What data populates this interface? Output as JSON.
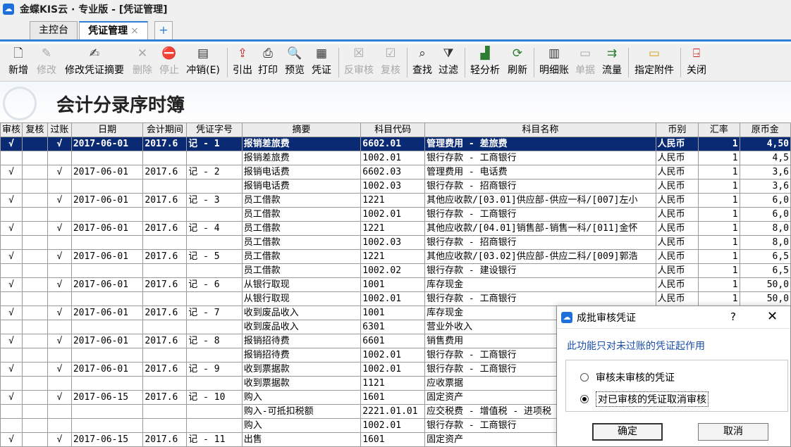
{
  "app": {
    "title": "金蝶KIS云 · 专业版 - [凭证管理]",
    "icon": "kis-app-icon"
  },
  "tabs": [
    {
      "label": "主控台"
    },
    {
      "label": "凭证管理",
      "close": "×"
    },
    {
      "label": "+"
    }
  ],
  "toolbar": [
    {
      "label": "新增",
      "icon": "new-doc-icon",
      "enabled": true
    },
    {
      "label": "修改",
      "icon": "edit-icon",
      "enabled": false
    },
    {
      "label": "修改凭证摘要",
      "icon": "edit-summary-icon",
      "enabled": true
    },
    {
      "label": "删除",
      "icon": "delete-icon",
      "enabled": false
    },
    {
      "label": "停止",
      "icon": "stop-icon",
      "enabled": false
    },
    {
      "label": "冲销(E)",
      "icon": "reverse-icon",
      "enabled": true
    },
    {
      "label": "引出",
      "icon": "export-icon",
      "enabled": true
    },
    {
      "label": "打印",
      "icon": "print-icon",
      "enabled": true
    },
    {
      "label": "预览",
      "icon": "preview-icon",
      "enabled": true
    },
    {
      "label": "凭证",
      "icon": "voucher-icon",
      "enabled": true
    },
    {
      "label": "反审核",
      "icon": "unaudit-icon",
      "enabled": false
    },
    {
      "label": "复核",
      "icon": "recheck-icon",
      "enabled": false
    },
    {
      "label": "查找",
      "icon": "find-icon",
      "enabled": true
    },
    {
      "label": "过滤",
      "icon": "filter-icon",
      "enabled": true
    },
    {
      "label": "轻分析",
      "icon": "analysis-icon",
      "enabled": true
    },
    {
      "label": "刷新",
      "icon": "refresh-icon",
      "enabled": true
    },
    {
      "label": "明细账",
      "icon": "ledger-icon",
      "enabled": true
    },
    {
      "label": "单据",
      "icon": "document-icon",
      "enabled": false
    },
    {
      "label": "流量",
      "icon": "flow-icon",
      "enabled": true
    },
    {
      "label": "指定附件",
      "icon": "attachment-folder-icon",
      "enabled": true
    },
    {
      "label": "关闭",
      "icon": "exit-door-icon",
      "enabled": true
    }
  ],
  "page_title": "会计分录序时簿",
  "table": {
    "columns": [
      "审核",
      "复核",
      "过账",
      "日期",
      "会计期间",
      "凭证字号",
      "摘要",
      "科目代码",
      "科目名称",
      "币别",
      "汇率",
      "原币金"
    ],
    "rows": [
      {
        "audit": "√",
        "recheck": "",
        "posted": "√",
        "date": "2017-06-01",
        "period": "2017.6",
        "voucher": "记 - 1",
        "summary": "报销差旅费",
        "code": "6602.01",
        "account": "管理费用 - 差旅费",
        "currency": "人民币",
        "rate": "1",
        "amount": "4,50",
        "selected": true
      },
      {
        "audit": "",
        "recheck": "",
        "posted": "",
        "date": "",
        "period": "",
        "voucher": "",
        "summary": "报销差旅费",
        "code": "1002.01",
        "account": "银行存款 - 工商银行",
        "currency": "人民币",
        "rate": "1",
        "amount": "4,5"
      },
      {
        "audit": "√",
        "recheck": "",
        "posted": "√",
        "date": "2017-06-01",
        "period": "2017.6",
        "voucher": "记 - 2",
        "summary": "报销电话费",
        "code": "6602.03",
        "account": "管理费用 - 电话费",
        "currency": "人民币",
        "rate": "1",
        "amount": "3,6"
      },
      {
        "audit": "",
        "recheck": "",
        "posted": "",
        "date": "",
        "period": "",
        "voucher": "",
        "summary": "报销电话费",
        "code": "1002.03",
        "account": "银行存款 - 招商银行",
        "currency": "人民币",
        "rate": "1",
        "amount": "3,6"
      },
      {
        "audit": "√",
        "recheck": "",
        "posted": "√",
        "date": "2017-06-01",
        "period": "2017.6",
        "voucher": "记 - 3",
        "summary": "员工借款",
        "code": "1221",
        "account": "其他应收款/[03.01]供应部-供应一科/[007]左小",
        "currency": "人民币",
        "rate": "1",
        "amount": "6,0"
      },
      {
        "audit": "",
        "recheck": "",
        "posted": "",
        "date": "",
        "period": "",
        "voucher": "",
        "summary": "员工借款",
        "code": "1002.01",
        "account": "银行存款 - 工商银行",
        "currency": "人民币",
        "rate": "1",
        "amount": "6,0"
      },
      {
        "audit": "√",
        "recheck": "",
        "posted": "√",
        "date": "2017-06-01",
        "period": "2017.6",
        "voucher": "记 - 4",
        "summary": "员工借款",
        "code": "1221",
        "account": "其他应收款/[04.01]销售部-销售一科/[011]金怀",
        "currency": "人民币",
        "rate": "1",
        "amount": "8,0"
      },
      {
        "audit": "",
        "recheck": "",
        "posted": "",
        "date": "",
        "period": "",
        "voucher": "",
        "summary": "员工借款",
        "code": "1002.03",
        "account": "银行存款 - 招商银行",
        "currency": "人民币",
        "rate": "1",
        "amount": "8,0"
      },
      {
        "audit": "√",
        "recheck": "",
        "posted": "√",
        "date": "2017-06-01",
        "period": "2017.6",
        "voucher": "记 - 5",
        "summary": "员工借款",
        "code": "1221",
        "account": "其他应收款/[03.02]供应部-供应二科/[009]郭浩",
        "currency": "人民币",
        "rate": "1",
        "amount": "6,5"
      },
      {
        "audit": "",
        "recheck": "",
        "posted": "",
        "date": "",
        "period": "",
        "voucher": "",
        "summary": "员工借款",
        "code": "1002.02",
        "account": "银行存款 - 建设银行",
        "currency": "人民币",
        "rate": "1",
        "amount": "6,5"
      },
      {
        "audit": "√",
        "recheck": "",
        "posted": "√",
        "date": "2017-06-01",
        "period": "2017.6",
        "voucher": "记 - 6",
        "summary": "从银行取现",
        "code": "1001",
        "account": "库存现金",
        "currency": "人民币",
        "rate": "1",
        "amount": "50,0"
      },
      {
        "audit": "",
        "recheck": "",
        "posted": "",
        "date": "",
        "period": "",
        "voucher": "",
        "summary": "从银行取现",
        "code": "1002.01",
        "account": "银行存款 - 工商银行",
        "currency": "人民币",
        "rate": "1",
        "amount": "50,0"
      },
      {
        "audit": "√",
        "recheck": "",
        "posted": "√",
        "date": "2017-06-01",
        "period": "2017.6",
        "voucher": "记 - 7",
        "summary": "收到废品收入",
        "code": "1001",
        "account": "库存现金",
        "currency": "",
        "rate": "",
        "amount": ""
      },
      {
        "audit": "",
        "recheck": "",
        "posted": "",
        "date": "",
        "period": "",
        "voucher": "",
        "summary": "收到废品收入",
        "code": "6301",
        "account": "营业外收入",
        "currency": "",
        "rate": "",
        "amount": ""
      },
      {
        "audit": "√",
        "recheck": "",
        "posted": "√",
        "date": "2017-06-01",
        "period": "2017.6",
        "voucher": "记 - 8",
        "summary": "报销招待费",
        "code": "6601",
        "account": "销售费用",
        "currency": "",
        "rate": "",
        "amount": ""
      },
      {
        "audit": "",
        "recheck": "",
        "posted": "",
        "date": "",
        "period": "",
        "voucher": "",
        "summary": "报销招待费",
        "code": "1002.01",
        "account": "银行存款 - 工商银行",
        "currency": "",
        "rate": "",
        "amount": ""
      },
      {
        "audit": "√",
        "recheck": "",
        "posted": "√",
        "date": "2017-06-01",
        "period": "2017.6",
        "voucher": "记 - 9",
        "summary": "收到票据款",
        "code": "1002.01",
        "account": "银行存款 - 工商银行",
        "currency": "",
        "rate": "",
        "amount": ""
      },
      {
        "audit": "",
        "recheck": "",
        "posted": "",
        "date": "",
        "period": "",
        "voucher": "",
        "summary": "收到票据款",
        "code": "1121",
        "account": "应收票据",
        "currency": "",
        "rate": "",
        "amount": ""
      },
      {
        "audit": "√",
        "recheck": "",
        "posted": "√",
        "date": "2017-06-15",
        "period": "2017.6",
        "voucher": "记 - 10",
        "summary": "购入",
        "code": "1601",
        "account": "固定资产",
        "currency": "",
        "rate": "",
        "amount": ""
      },
      {
        "audit": "",
        "recheck": "",
        "posted": "",
        "date": "",
        "period": "",
        "voucher": "",
        "summary": "购入-可抵扣税额",
        "code": "2221.01.01",
        "account": "应交税费 - 增值税 - 进项税",
        "currency": "",
        "rate": "",
        "amount": ""
      },
      {
        "audit": "",
        "recheck": "",
        "posted": "",
        "date": "",
        "period": "",
        "voucher": "",
        "summary": "购入",
        "code": "1002.01",
        "account": "银行存款 - 工商银行",
        "currency": "",
        "rate": "",
        "amount": ""
      },
      {
        "audit": "√",
        "recheck": "",
        "posted": "√",
        "date": "2017-06-15",
        "period": "2017.6",
        "voucher": "记 - 11",
        "summary": "出售",
        "code": "1601",
        "account": "固定资产",
        "currency": "",
        "rate": "",
        "amount": ""
      }
    ]
  },
  "dialog": {
    "title": "成批审核凭证",
    "help": "?",
    "close": "✕",
    "info": "此功能只对未过账的凭证起作用",
    "options": [
      {
        "label": "审核未审核的凭证",
        "selected": false
      },
      {
        "label": "对已审核的凭证取消审核",
        "selected": true
      }
    ],
    "ok": "确定",
    "cancel": "取消"
  }
}
